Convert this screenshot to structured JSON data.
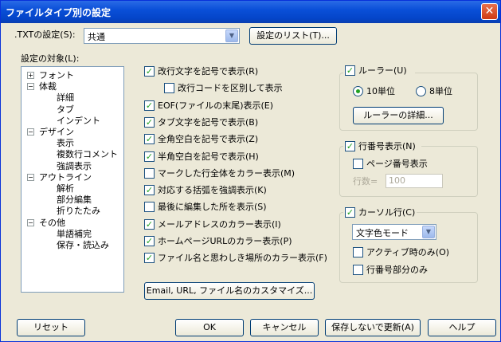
{
  "window": {
    "title": "ファイルタイプ別の設定"
  },
  "top": {
    "filetype_label": ".TXTの設定(S):",
    "filetype_value": "共通",
    "settings_list_button": "設定のリスト(T)..."
  },
  "target_label": "設定の対象(L):",
  "tree": [
    {
      "label": "フォント",
      "indent": 0,
      "expander": "+"
    },
    {
      "label": "体裁",
      "indent": 0,
      "expander": "−"
    },
    {
      "label": "詳細",
      "indent": 1
    },
    {
      "label": "タブ",
      "indent": 1
    },
    {
      "label": "インデント",
      "indent": 1
    },
    {
      "label": "デザイン",
      "indent": 0,
      "expander": "−"
    },
    {
      "label": "表示",
      "indent": 1
    },
    {
      "label": "複数行コメント",
      "indent": 1
    },
    {
      "label": "強調表示",
      "indent": 1
    },
    {
      "label": "アウトライン",
      "indent": 0,
      "expander": "−"
    },
    {
      "label": "解析",
      "indent": 1
    },
    {
      "label": "部分編集",
      "indent": 1
    },
    {
      "label": "折りたたみ",
      "indent": 1
    },
    {
      "label": "その他",
      "indent": 0,
      "expander": "−"
    },
    {
      "label": "単語補完",
      "indent": 1
    },
    {
      "label": "保存・読込み",
      "indent": 1
    }
  ],
  "options": [
    {
      "label": "改行文字を記号で表示(R)",
      "checked": true,
      "indent": false
    },
    {
      "label": "改行コードを区別して表示",
      "checked": false,
      "indent": true
    },
    {
      "label": "EOF(ファイルの末尾)表示(E)",
      "checked": true,
      "indent": false
    },
    {
      "label": "タブ文字を記号で表示(B)",
      "checked": true,
      "indent": false
    },
    {
      "label": "全角空白を記号で表示(Z)",
      "checked": true,
      "indent": false
    },
    {
      "label": "半角空白を記号で表示(H)",
      "checked": true,
      "indent": false
    },
    {
      "label": "マークした行全体をカラー表示(M)",
      "checked": false,
      "indent": false
    },
    {
      "label": "対応する括弧を強調表示(K)",
      "checked": true,
      "indent": false
    },
    {
      "label": "最後に編集した所を表示(S)",
      "checked": false,
      "indent": false
    },
    {
      "label": "メールアドレスのカラー表示(I)",
      "checked": true,
      "indent": false
    },
    {
      "label": "ホームページURLのカラー表示(P)",
      "checked": true,
      "indent": false
    },
    {
      "label": "ファイル名と思わしき場所のカラー表示(F)",
      "checked": true,
      "indent": false
    }
  ],
  "customize_button": "Email, URL, ファイル名のカスタマイズ...",
  "ruler": {
    "label": "ルーラー(U)",
    "checked": true,
    "unit10": "10単位",
    "unit8": "8単位",
    "selected_unit": "10",
    "detail_button": "ルーラーの詳細..."
  },
  "linenum": {
    "label": "行番号表示(N)",
    "checked": true,
    "page_label": "ページ番号表示",
    "page_checked": false,
    "lines_label": "行数=",
    "lines_value": "100"
  },
  "cursor": {
    "label": "カーソル行(C)",
    "checked": true,
    "mode_value": "文字色モード",
    "active_label": "アクティブ時のみ(O)",
    "active_checked": false,
    "linenum_part_label": "行番号部分のみ",
    "linenum_part_checked": false
  },
  "footer": {
    "reset": "リセット",
    "ok": "OK",
    "cancel": "キャンセル",
    "update": "保存しないで更新(A)",
    "help": "ヘルプ"
  }
}
